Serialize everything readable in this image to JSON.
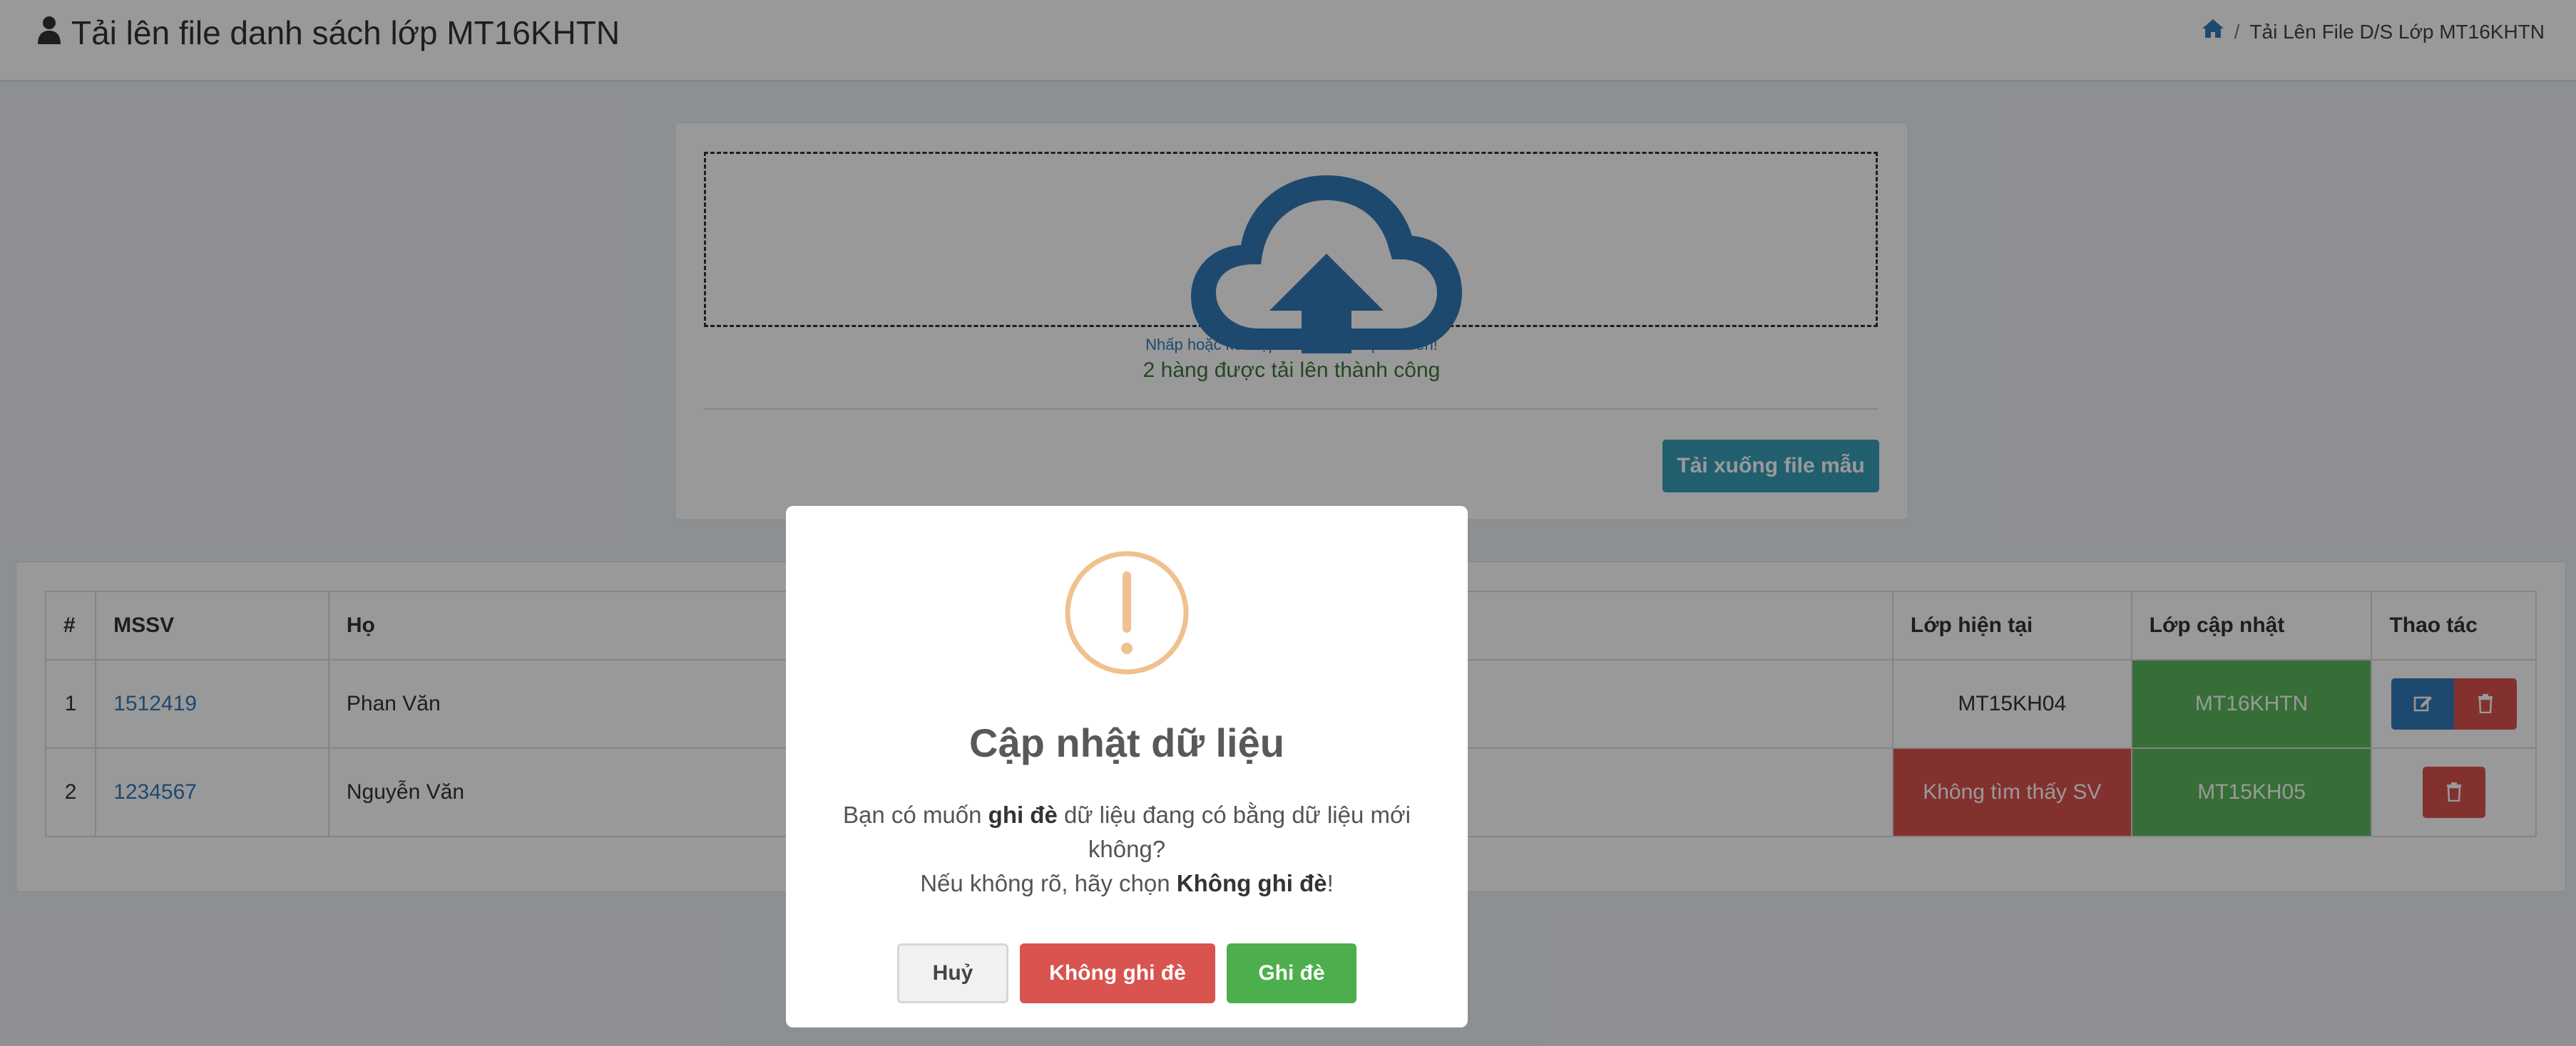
{
  "header": {
    "title": "Tải lên file danh sách lớp MT16KHTN",
    "breadcrumb_current": "Tải Lên File D/S Lớp MT16KHTN"
  },
  "upload": {
    "hint": "Nhấp hoặc kéo tập tin thả vào ô phía trên!",
    "status": "2 hàng được tải lên thành công",
    "download_button": "Tải xuống file mẫu"
  },
  "table": {
    "headers": [
      "#",
      "MSSV",
      "Họ",
      "Lớp hiện tại",
      "Lớp cập nhật",
      "Thao tác"
    ],
    "rows": [
      {
        "index": "1",
        "mssv": "1512419",
        "ho": "Phan Văn",
        "lop_hien_tai": "MT15KH04",
        "lop_cap_nhat": "MT16KHTN"
      },
      {
        "index": "2",
        "mssv": "1234567",
        "ho": "Nguyễn Văn",
        "lop_hien_tai": "Không tìm thấy SV",
        "lop_cap_nhat": "MT15KH05"
      }
    ]
  },
  "modal": {
    "title": "Cập nhật dữ liệu",
    "line1_pre": "Bạn có muốn ",
    "line1_bold": "ghi đè",
    "line1_post": " dữ liệu đang có bằng dữ liệu mới không?",
    "line2_pre": "Nếu không rõ, hãy chọn ",
    "line2_bold": "Không ghi đè",
    "line2_post": "!",
    "cancel": "Huỷ",
    "no_overwrite": "Không ghi đè",
    "overwrite": "Ghi đè"
  },
  "colors": {
    "accent_blue": "#337ab7",
    "danger": "#d9534f",
    "success": "#5cb85c",
    "warning_icon": "#f0c18e"
  },
  "icons": [
    "user-icon",
    "home-icon",
    "cloud-upload-icon",
    "edit-icon",
    "trash-icon",
    "exclamation-icon"
  ]
}
